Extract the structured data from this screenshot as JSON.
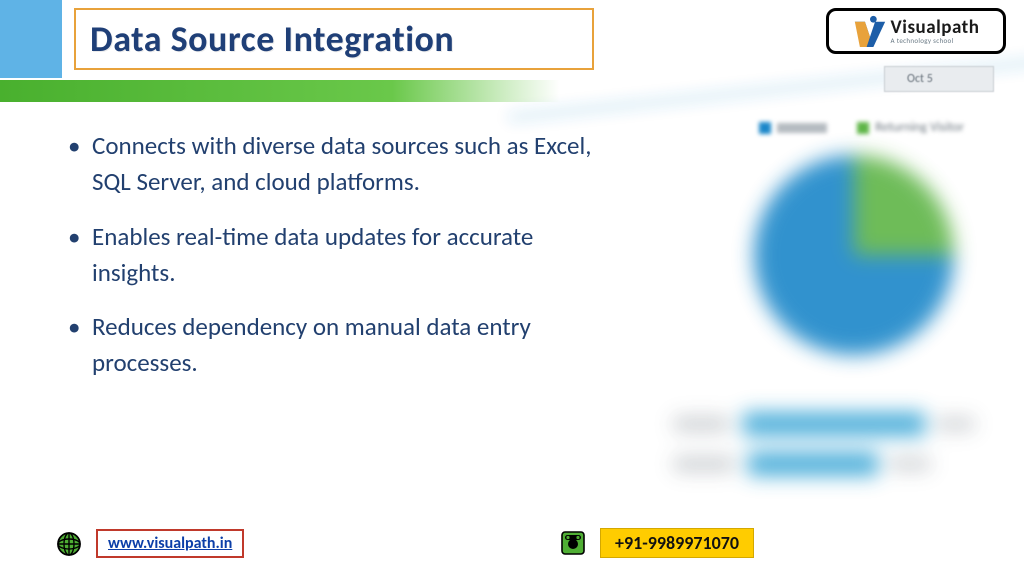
{
  "title": "Data Source Integration",
  "logo": {
    "brand": "Visualpath",
    "tagline": "A technology school"
  },
  "bullets": [
    "Connects with diverse data sources such as Excel, SQL Server, and cloud platforms.",
    "Enables real-time data updates for accurate insights.",
    "Reduces dependency on manual data entry processes."
  ],
  "footer": {
    "website": "www.visualpath.in",
    "phone": "+91-9989971070"
  },
  "background": {
    "date_tab": "Oct 5",
    "legend_returning": "Returning Visitor"
  }
}
